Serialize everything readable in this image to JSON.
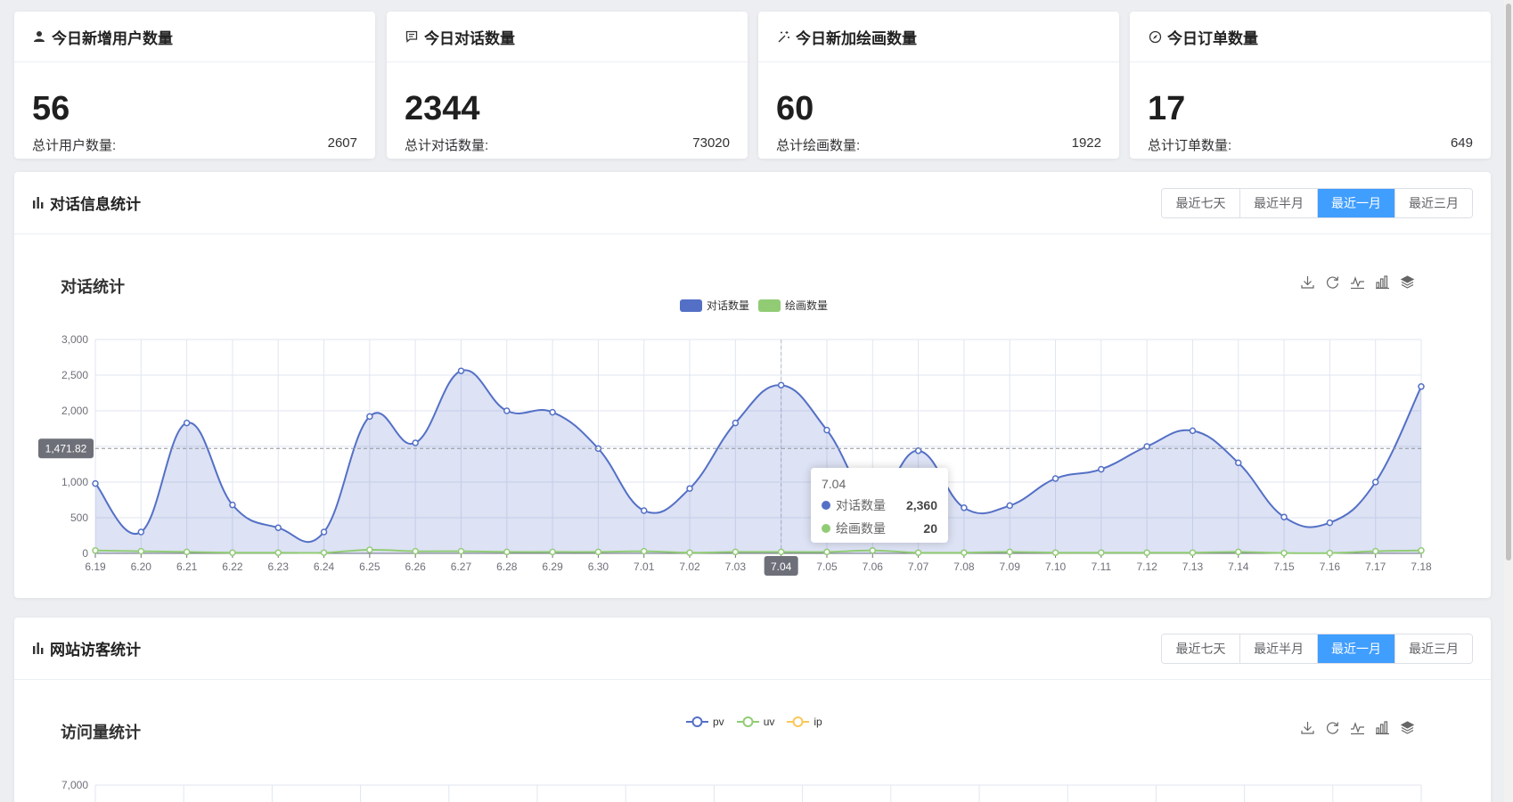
{
  "stats": [
    {
      "title": "今日新增用户数量",
      "icon": "user-icon",
      "value": "56",
      "sub_label": "总计用户数量:",
      "sub_value": "2607"
    },
    {
      "title": "今日对话数量",
      "icon": "message-icon",
      "value": "2344",
      "sub_label": "总计对话数量:",
      "sub_value": "73020"
    },
    {
      "title": "今日新加绘画数量",
      "icon": "magic-icon",
      "value": "60",
      "sub_label": "总计绘画数量:",
      "sub_value": "1922"
    },
    {
      "title": "今日订单数量",
      "icon": "compass-icon",
      "value": "17",
      "sub_label": "总计订单数量:",
      "sub_value": "649"
    }
  ],
  "range_buttons": [
    "最近七天",
    "最近半月",
    "最近一月",
    "最近三月"
  ],
  "active_range_index": 2,
  "dialog_panel": {
    "title": "对话信息统计",
    "icon": "bar-chart-icon"
  },
  "visitor_panel": {
    "title": "网站访客统计",
    "icon": "bar-chart-icon"
  },
  "toolbox_icons": [
    "download-icon",
    "refresh-icon",
    "line-chart-icon",
    "bar-chart-icon",
    "stack-icon"
  ],
  "colors": {
    "primary": "#409eff",
    "dialog_series": "#5470c6",
    "draw_series": "#91cc75",
    "ip_series": "#fac858"
  },
  "chart_data": [
    {
      "type": "area",
      "title": "对话统计",
      "x": [
        "6.19",
        "6.20",
        "6.21",
        "6.22",
        "6.23",
        "6.24",
        "6.25",
        "6.26",
        "6.27",
        "6.28",
        "6.29",
        "6.30",
        "7.01",
        "7.02",
        "7.03",
        "7.04",
        "7.05",
        "7.06",
        "7.07",
        "7.08",
        "7.09",
        "7.10",
        "7.11",
        "7.12",
        "7.13",
        "7.14",
        "7.15",
        "7.16",
        "7.17",
        "7.18"
      ],
      "series": [
        {
          "name": "对话数量",
          "values": [
            980,
            300,
            1830,
            680,
            360,
            300,
            1920,
            1550,
            2560,
            2000,
            1980,
            1470,
            600,
            910,
            1830,
            2360,
            1730,
            760,
            1440,
            640,
            670,
            1050,
            1180,
            1500,
            1720,
            1270,
            510,
            430,
            1000,
            2340
          ]
        },
        {
          "name": "绘画数量",
          "values": [
            40,
            30,
            20,
            10,
            10,
            10,
            50,
            30,
            30,
            20,
            20,
            20,
            30,
            10,
            20,
            20,
            20,
            40,
            10,
            10,
            20,
            10,
            10,
            10,
            10,
            20,
            5,
            5,
            30,
            40
          ]
        }
      ],
      "ylim": [
        0,
        3000
      ],
      "yticks": [
        "0",
        "500",
        "1,000",
        "1,500",
        "2,000",
        "2,500",
        "3,000"
      ],
      "average_label": "1,471.82",
      "average_value": 1471.82,
      "highlight_x_label": "7.04",
      "highlight_index": 15,
      "tooltip": {
        "title": "7.04",
        "rows": [
          {
            "name": "对话数量",
            "value": "2,360"
          },
          {
            "name": "绘画数量",
            "value": "20"
          }
        ]
      },
      "grid": true,
      "legend": "top-center"
    },
    {
      "type": "line",
      "title": "访问量统计",
      "series": [
        {
          "name": "pv"
        },
        {
          "name": "uv"
        },
        {
          "name": "ip"
        }
      ],
      "yticks_visible": [
        "7,000"
      ],
      "legend": "top-center"
    }
  ]
}
